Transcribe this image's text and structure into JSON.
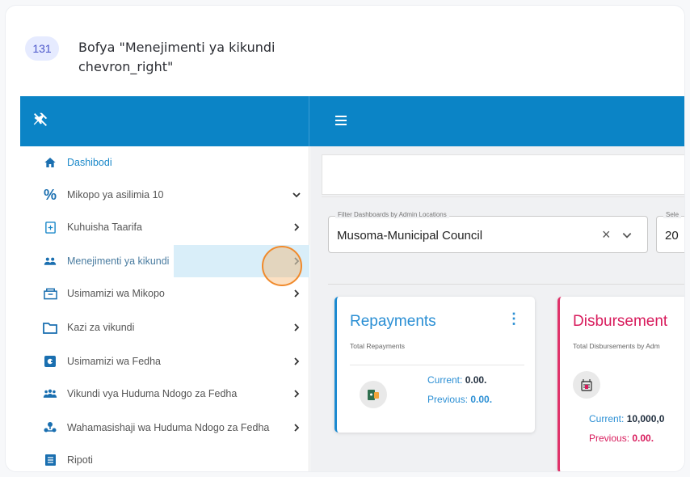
{
  "step": {
    "number": "131",
    "instruction": "Bofya \"Menejimenti ya kikundi chevron_right\""
  },
  "sidebar": {
    "items": [
      {
        "label": "Dashibodi",
        "icon": "home-icon"
      },
      {
        "label": "Mikopo ya asilimia 10",
        "icon": "percent-icon",
        "chevron": "chevron-down-icon"
      },
      {
        "label": "Kuhuisha Taarifa",
        "icon": "update-icon",
        "chevron": "chevron-right-icon"
      },
      {
        "label": "Menejimenti ya kikundi",
        "icon": "group-icon",
        "chevron": "chevron-right-icon"
      },
      {
        "label": "Usimamizi wa Mikopo",
        "icon": "loan-icon",
        "chevron": "chevron-right-icon"
      },
      {
        "label": "Kazi za vikundi",
        "icon": "folder-icon",
        "chevron": "chevron-right-icon"
      },
      {
        "label": "Usimamizi wa Fedha",
        "icon": "finance-icon",
        "chevron": "chevron-right-icon"
      },
      {
        "label": "Vikundi vya Huduma Ndogo za Fedha",
        "icon": "people-icon",
        "chevron": "chevron-right-icon"
      },
      {
        "label": "Wahamasishaji wa Huduma Ndogo za Fedha",
        "icon": "mobilizer-icon",
        "chevron": "chevron-right-icon"
      },
      {
        "label": "Ripoti",
        "icon": "report-icon"
      }
    ]
  },
  "filters": {
    "admin_label": "Filter Dashboards by Admin Locations",
    "admin_value": "Musoma-Municipal Council",
    "second_label": "Sele",
    "second_value": "20"
  },
  "cards": {
    "repayments": {
      "title": "Repayments",
      "subtitle": "Total Repayments",
      "current_label": "Current:",
      "current_value": "0.00.",
      "previous_label": "Previous:",
      "previous_value": "0.00."
    },
    "disbursement": {
      "title": "Disbursement",
      "subtitle": "Total Disbursements by Adm",
      "current_label": "Current:",
      "current_value": "10,000,0",
      "previous_label": "Previous:",
      "previous_value": "0.00."
    }
  },
  "colors": {
    "topbar": "#0b84c6",
    "repayments_accent": "#1c8ad0",
    "disbursement_accent": "#d81b5c",
    "highlight": "#f08a2c"
  }
}
